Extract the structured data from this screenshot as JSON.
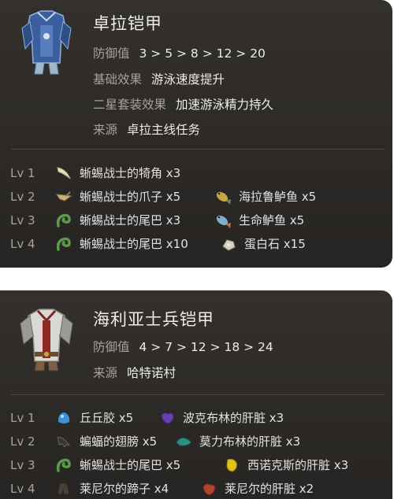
{
  "armors": [
    {
      "name": "卓拉铠甲",
      "portrait_icon": "zora-armor-icon",
      "stats": [
        {
          "label": "防御值",
          "value": "3 > 5 > 8 > 12 > 20"
        },
        {
          "label": "基础效果",
          "value": "游泳速度提升"
        },
        {
          "label": "二星套装效果",
          "value": "加速游泳精力持久"
        },
        {
          "label": "来源",
          "value": "卓拉主线任务"
        }
      ],
      "levels": [
        {
          "level": "Lv 1",
          "materials": [
            {
              "text": "蜥蜴战士的犄角 x3",
              "icon": "lizalfos-horn-icon"
            }
          ]
        },
        {
          "level": "Lv 2",
          "materials": [
            {
              "text": "蜥蜴战士的爪子 x5",
              "icon": "lizalfos-talon-icon"
            },
            {
              "text": "海拉鲁鲈鱼 x5",
              "icon": "hyrule-bass-icon"
            }
          ]
        },
        {
          "level": "Lv 3",
          "materials": [
            {
              "text": "蜥蜴战士的尾巴 x3",
              "icon": "lizalfos-tail-icon"
            },
            {
              "text": "生命鲈鱼 x5",
              "icon": "hearty-bass-icon"
            }
          ]
        },
        {
          "level": "Lv 4",
          "materials": [
            {
              "text": "蜥蜴战士的尾巴 x10",
              "icon": "lizalfos-tail-icon"
            },
            {
              "text": "蛋白石 x15",
              "icon": "opal-icon"
            }
          ]
        }
      ]
    },
    {
      "name": "海利亚士兵铠甲",
      "portrait_icon": "soldier-armor-icon",
      "stats": [
        {
          "label": "防御值",
          "value": "4 > 7 > 12 > 18 > 24"
        },
        {
          "label": "来源",
          "value": "哈特诺村"
        }
      ],
      "levels": [
        {
          "level": "Lv 1",
          "materials": [
            {
              "text": "丘丘胶 x5",
              "icon": "chuchu-jelly-icon"
            },
            {
              "text": "波克布林的肝脏 x3",
              "icon": "bokoblin-guts-icon"
            }
          ]
        },
        {
          "level": "Lv 2",
          "materials": [
            {
              "text": "蝙蝠的翅膀 x5",
              "icon": "keese-wing-icon"
            },
            {
              "text": "莫力布林的肝脏 x3",
              "icon": "moblin-guts-icon"
            }
          ]
        },
        {
          "level": "Lv 3",
          "materials": [
            {
              "text": "蜥蜴战士的尾巴 x5",
              "icon": "lizalfos-tail-icon"
            },
            {
              "text": "西诺克斯的肝脏 x3",
              "icon": "hinox-guts-icon"
            }
          ]
        },
        {
          "level": "Lv 4",
          "materials": [
            {
              "text": "莱尼尔的蹄子 x4",
              "icon": "lynel-hoof-icon"
            },
            {
              "text": "莱尼尔的肝脏 x2",
              "icon": "lynel-guts-icon"
            }
          ]
        }
      ]
    }
  ]
}
